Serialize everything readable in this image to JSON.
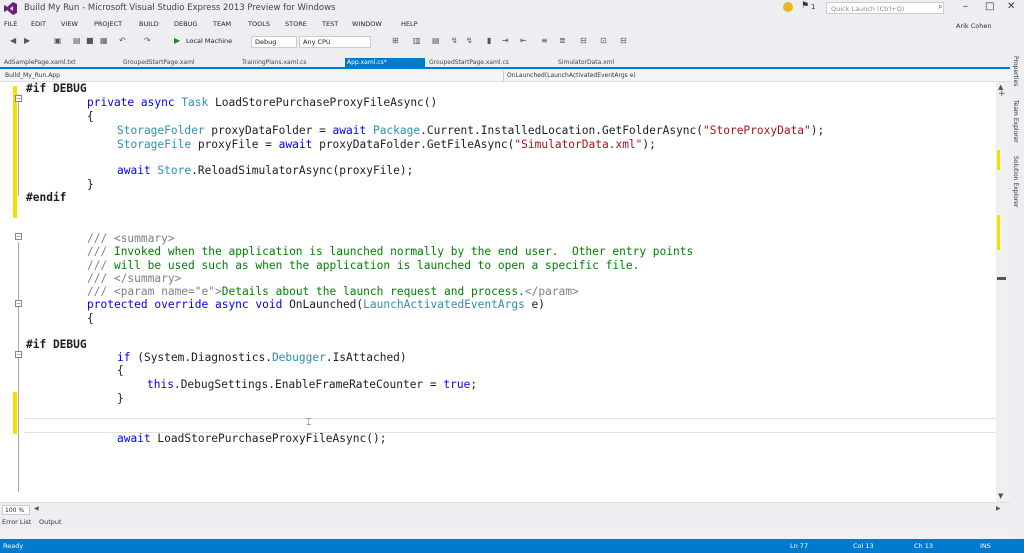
{
  "titlebar": {
    "title": "Build My Run - Microsoft Visual Studio Express 2013 Preview for Windows",
    "notifications_count": "1",
    "quick_launch_placeholder": "Quick Launch (Ctrl+Q)",
    "minimize": "–",
    "maximize": "□",
    "close": "✕"
  },
  "menu": {
    "items": [
      "FILE",
      "EDIT",
      "VIEW",
      "PROJECT",
      "BUILD",
      "DEBUG",
      "TEAM",
      "TOOLS",
      "STORE",
      "TEST",
      "WINDOW",
      "HELP"
    ],
    "user": "Arik Cohen"
  },
  "toolbar": {
    "run_target": "Local Machine",
    "configuration": "Debug",
    "platform": "Any CPU"
  },
  "tabs": [
    "AdSamplePage.xaml.txt",
    "GroupedStartPage.xaml",
    "TrainingPlans.xaml.cs",
    "App.xaml.cs*",
    "GroupedStartPage.xaml.cs",
    "SimulatorData.xml"
  ],
  "navbar": {
    "project": "Build_My_Run.App",
    "member": "OnLaunched(LaunchActivatedEventArgs e)"
  },
  "code": {
    "l1": "#if DEBUG",
    "l2": [
      "private async ",
      "Task",
      " LoadStorePurchaseProxyFileAsync()"
    ],
    "l3": "{",
    "l4": [
      "StorageFolder",
      " proxyDataFolder = ",
      "await ",
      "Package",
      ".Current.InstalledLocation.GetFolderAsync(",
      "\"StoreProxyData\"",
      ");"
    ],
    "l5": [
      "StorageFile",
      " proxyFile = ",
      "await",
      " proxyDataFolder.GetFileAsync(",
      "\"SimulatorData.xml\"",
      ");"
    ],
    "l6": [
      "await ",
      "Store",
      ".ReloadSimulatorAsync(proxyFile);"
    ],
    "l7": "}",
    "l8": "#endif",
    "l9": [
      "/// ",
      "<summary>"
    ],
    "l10": [
      "/// ",
      "Invoked when the application is launched normally by the end user.  Other entry points"
    ],
    "l11": [
      "/// ",
      "will be used such as when the application is launched to open a specific file."
    ],
    "l12": [
      "/// ",
      "</summary>"
    ],
    "l13": [
      "/// ",
      "<param name=\"e\">",
      "Details about the launch request and process.",
      "</param>"
    ],
    "l14": [
      "protected override async void",
      " OnLaunched(",
      "LaunchActivatedEventArgs",
      " e)"
    ],
    "l15": "{",
    "l16": "#if DEBUG",
    "l17": [
      "if",
      " (System.Diagnostics.",
      "Debugger",
      ".IsAttached)"
    ],
    "l18": "{",
    "l19": [
      "this",
      ".DebugSettings.EnableFrameRateCounter = ",
      "true",
      ";"
    ],
    "l20": "}",
    "l21": [
      "await",
      " LoadStorePurchaseProxyFileAsync();"
    ]
  },
  "zoom": "100 %",
  "bottom_tabs": [
    "Error List",
    "Output"
  ],
  "status": {
    "ready": "Ready",
    "ln": "Ln 77",
    "col": "Col 13",
    "ch": "Ch 13",
    "ins": "INS"
  },
  "side_tabs": [
    "Properties",
    "Team Explorer",
    "Solution Explorer"
  ],
  "colors": {
    "accent": "#007acc",
    "keyword": "#0000ff",
    "type": "#2b91af",
    "string": "#a31515",
    "comment": "#008000",
    "change_marker": "#f1e200"
  }
}
